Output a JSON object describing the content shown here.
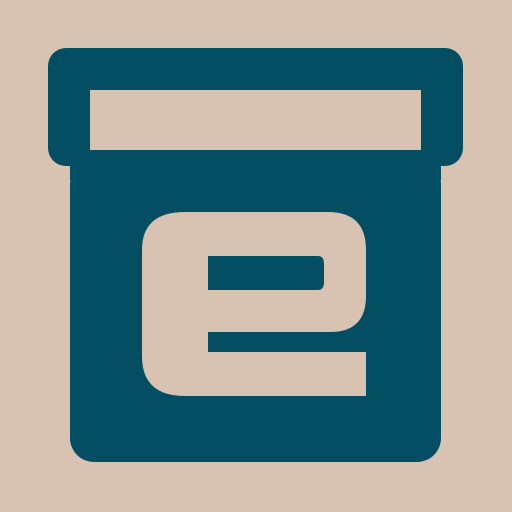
{
  "icon": {
    "name": "archive-box-logo-icon",
    "background_color": "#d8c2b1",
    "foreground_color": "#034e63"
  }
}
